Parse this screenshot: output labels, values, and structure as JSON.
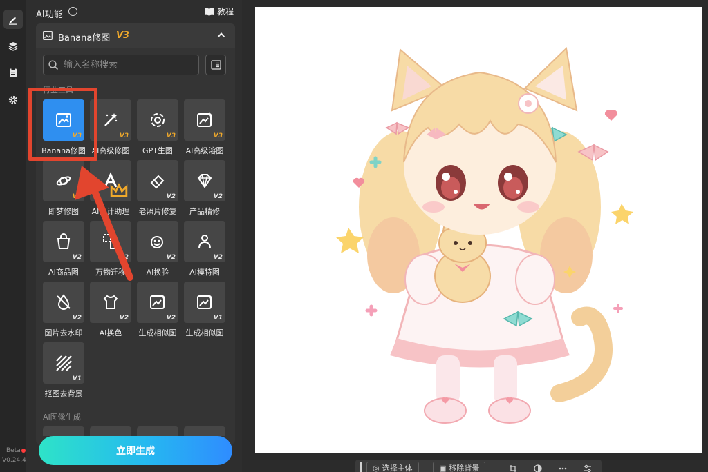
{
  "rail": {
    "items": [
      {
        "name": "edit",
        "icon": "pencil-icon",
        "active": true
      },
      {
        "name": "layers",
        "icon": "layers-icon",
        "active": false
      },
      {
        "name": "history",
        "icon": "clipboard-icon",
        "active": false
      },
      {
        "name": "settings",
        "icon": "gear-icon",
        "active": false
      }
    ],
    "beta_label": "Beta",
    "version": "V0.24.4"
  },
  "panel": {
    "title": "AI功能",
    "info_icon": "i",
    "tutorial_label": "教程",
    "card": {
      "title": "Banana修图",
      "version": "V3"
    },
    "search": {
      "placeholder": "输入名称搜索",
      "value": ""
    },
    "section_tools_label": "行业工具",
    "section_image_label": "AI图像生成",
    "tools": [
      {
        "label": "Banana修图",
        "icon": "image-edit-icon",
        "badge": "V3",
        "badge_style": "gold",
        "selected": true
      },
      {
        "label": "AI高级修图",
        "icon": "magic-wand-icon",
        "badge": "V3",
        "badge_style": "gold"
      },
      {
        "label": "GPT生图",
        "icon": "openai-icon",
        "badge": "V3",
        "badge_style": "gold"
      },
      {
        "label": "AI高级溶图",
        "icon": "image-sparkle-icon",
        "badge": "V3",
        "badge_style": "gold"
      },
      {
        "label": "即梦修图",
        "icon": "dream-planet-icon",
        "badge": "V3",
        "badge_style": "gold"
      },
      {
        "label": "AI设计助理",
        "icon": "design-assistant-icon",
        "badge": "",
        "badge_style": "crown"
      },
      {
        "label": "老照片修复",
        "icon": "eraser-icon",
        "badge": "V2",
        "badge_style": "white"
      },
      {
        "label": "产品精修",
        "icon": "diamond-icon",
        "badge": "V2",
        "badge_style": "white"
      },
      {
        "label": "AI商品图",
        "icon": "shopping-bag-icon",
        "badge": "V2",
        "badge_style": "white"
      },
      {
        "label": "万物迁移",
        "icon": "transfer-icon",
        "badge": "V2",
        "badge_style": "white"
      },
      {
        "label": "AI换脸",
        "icon": "face-swap-icon",
        "badge": "V2",
        "badge_style": "white"
      },
      {
        "label": "AI模特图",
        "icon": "model-person-icon",
        "badge": "V2",
        "badge_style": "white"
      },
      {
        "label": "图片去水印",
        "icon": "watermark-remove-icon",
        "badge": "V2",
        "badge_style": "white"
      },
      {
        "label": "AI换色",
        "icon": "shirt-color-icon",
        "badge": "V2",
        "badge_style": "white"
      },
      {
        "label": "生成相似图",
        "icon": "image-sparkle-icon",
        "badge": "V2",
        "badge_style": "white"
      },
      {
        "label": "生成相似图",
        "icon": "image-sparkle-icon",
        "badge": "V1",
        "badge_style": "white"
      },
      {
        "label": "抠图去背景",
        "icon": "hatch-cutout-icon",
        "badge": "V1",
        "badge_style": "white"
      }
    ],
    "generate_label": "立即生成"
  },
  "canvas": {
    "toolbar": {
      "select_subject_label": "选择主体",
      "remove_bg_label": "移除背景"
    }
  },
  "colors": {
    "accent": "#2f8ff0",
    "version_badge": "#f0a92b",
    "annotation": "#e2452e",
    "generate_gradient_start": "#2ee3c8",
    "generate_gradient_end": "#2f8cff"
  }
}
